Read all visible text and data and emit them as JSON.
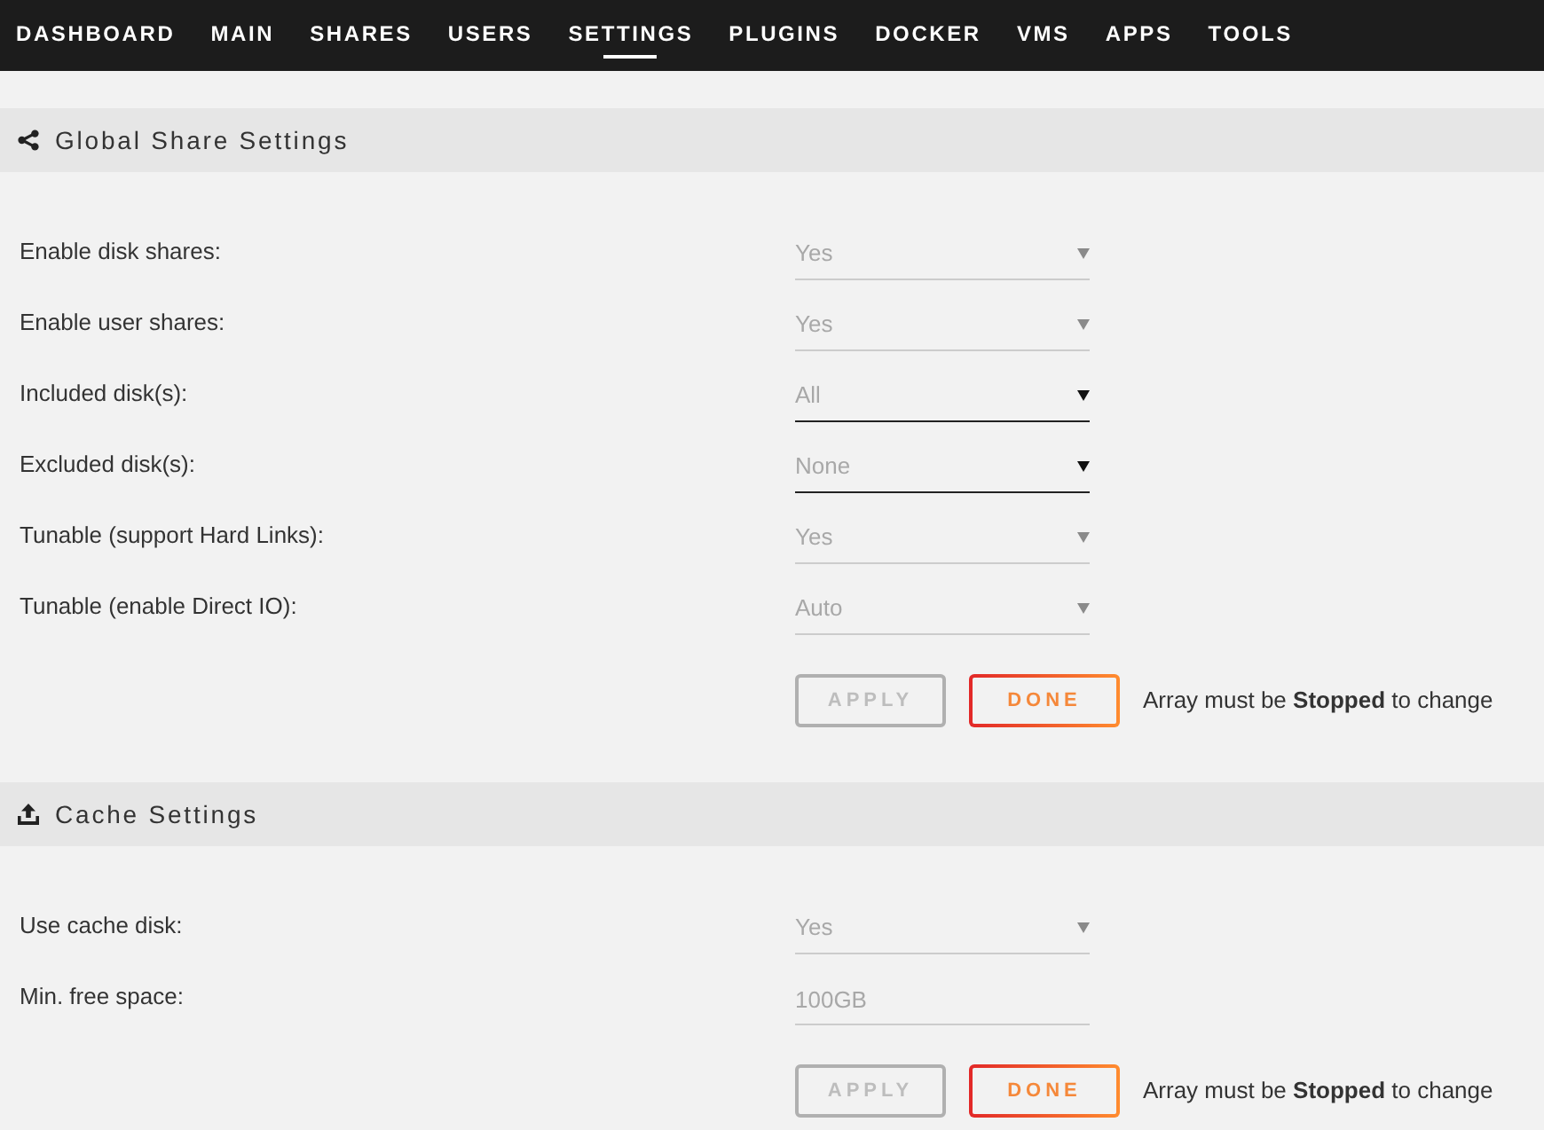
{
  "nav": [
    {
      "label": "DASHBOARD",
      "selected": false
    },
    {
      "label": "MAIN",
      "selected": false
    },
    {
      "label": "SHARES",
      "selected": false
    },
    {
      "label": "USERS",
      "selected": false
    },
    {
      "label": "SETTINGS",
      "selected": true
    },
    {
      "label": "PLUGINS",
      "selected": false
    },
    {
      "label": "DOCKER",
      "selected": false
    },
    {
      "label": "VMS",
      "selected": false
    },
    {
      "label": "APPS",
      "selected": false
    },
    {
      "label": "TOOLS",
      "selected": false
    }
  ],
  "sections": [
    {
      "title": "Global Share Settings",
      "fields": [
        {
          "label": "Enable disk shares:",
          "kind": "select",
          "value": "Yes",
          "disabled": true
        },
        {
          "label": "Enable user shares:",
          "kind": "select",
          "value": "Yes",
          "disabled": true
        },
        {
          "label": "Included disk(s):",
          "kind": "select",
          "value": "All",
          "disabled": false
        },
        {
          "label": "Excluded disk(s):",
          "kind": "select",
          "value": "None",
          "disabled": false
        },
        {
          "label": "Tunable (support Hard Links):",
          "kind": "select",
          "value": "Yes",
          "disabled": true
        },
        {
          "label": "Tunable (enable Direct IO):",
          "kind": "select",
          "value": "Auto",
          "disabled": true
        }
      ],
      "buttons": [
        {
          "label": "APPLY",
          "disabled": true
        },
        {
          "label": "DONE",
          "disabled": false
        }
      ],
      "note": "Array must be **Stopped** to change"
    },
    {
      "title": "Cache Settings",
      "fields": [
        {
          "label": "Use cache disk:",
          "kind": "select",
          "value": "Yes",
          "disabled": true
        },
        {
          "label": "Min. free space:",
          "kind": "input",
          "value": "100GB",
          "disabled": true
        }
      ],
      "buttons": [
        {
          "label": "APPLY",
          "disabled": true
        },
        {
          "label": "DONE",
          "disabled": false
        }
      ],
      "note": "Array must be **Stopped** to change"
    }
  ]
}
